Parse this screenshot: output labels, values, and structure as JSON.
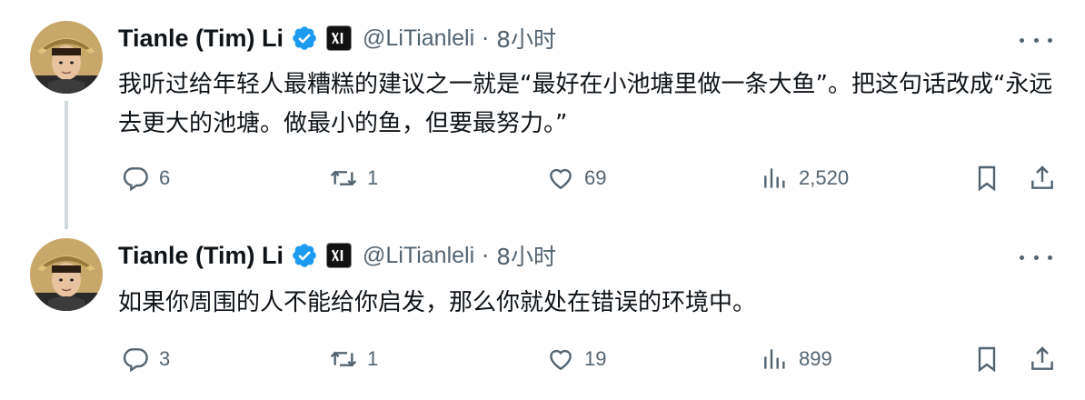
{
  "tweets": [
    {
      "author_name": "Tianle (Tim) Li",
      "handle": "@LiTianleli",
      "separator": "·",
      "time": "8小时",
      "affiliate_badge": "xl",
      "text": "我听过给年轻人最糟糕的建议之一就是“最好在小池塘里做一条大鱼”。把这句话改成“永远去更大的池塘。做最小的鱼，但要最努力。”",
      "replies": "6",
      "retweets": "1",
      "likes": "69",
      "views": "2,520"
    },
    {
      "author_name": "Tianle (Tim) Li",
      "handle": "@LiTianleli",
      "separator": "·",
      "time": "8小时",
      "affiliate_badge": "xl",
      "text": "如果你周围的人不能给你启发，那么你就处在错误的环境中。",
      "replies": "3",
      "retweets": "1",
      "likes": "19",
      "views": "899"
    }
  ],
  "colors": {
    "verified_blue": "#1d9bf0",
    "secondary_text": "#536471",
    "thread_line": "#cfd9de"
  },
  "icons": [
    "reply-icon",
    "retweet-icon",
    "like-icon",
    "views-icon",
    "bookmark-icon",
    "share-icon",
    "more-icon",
    "verified-icon"
  ]
}
